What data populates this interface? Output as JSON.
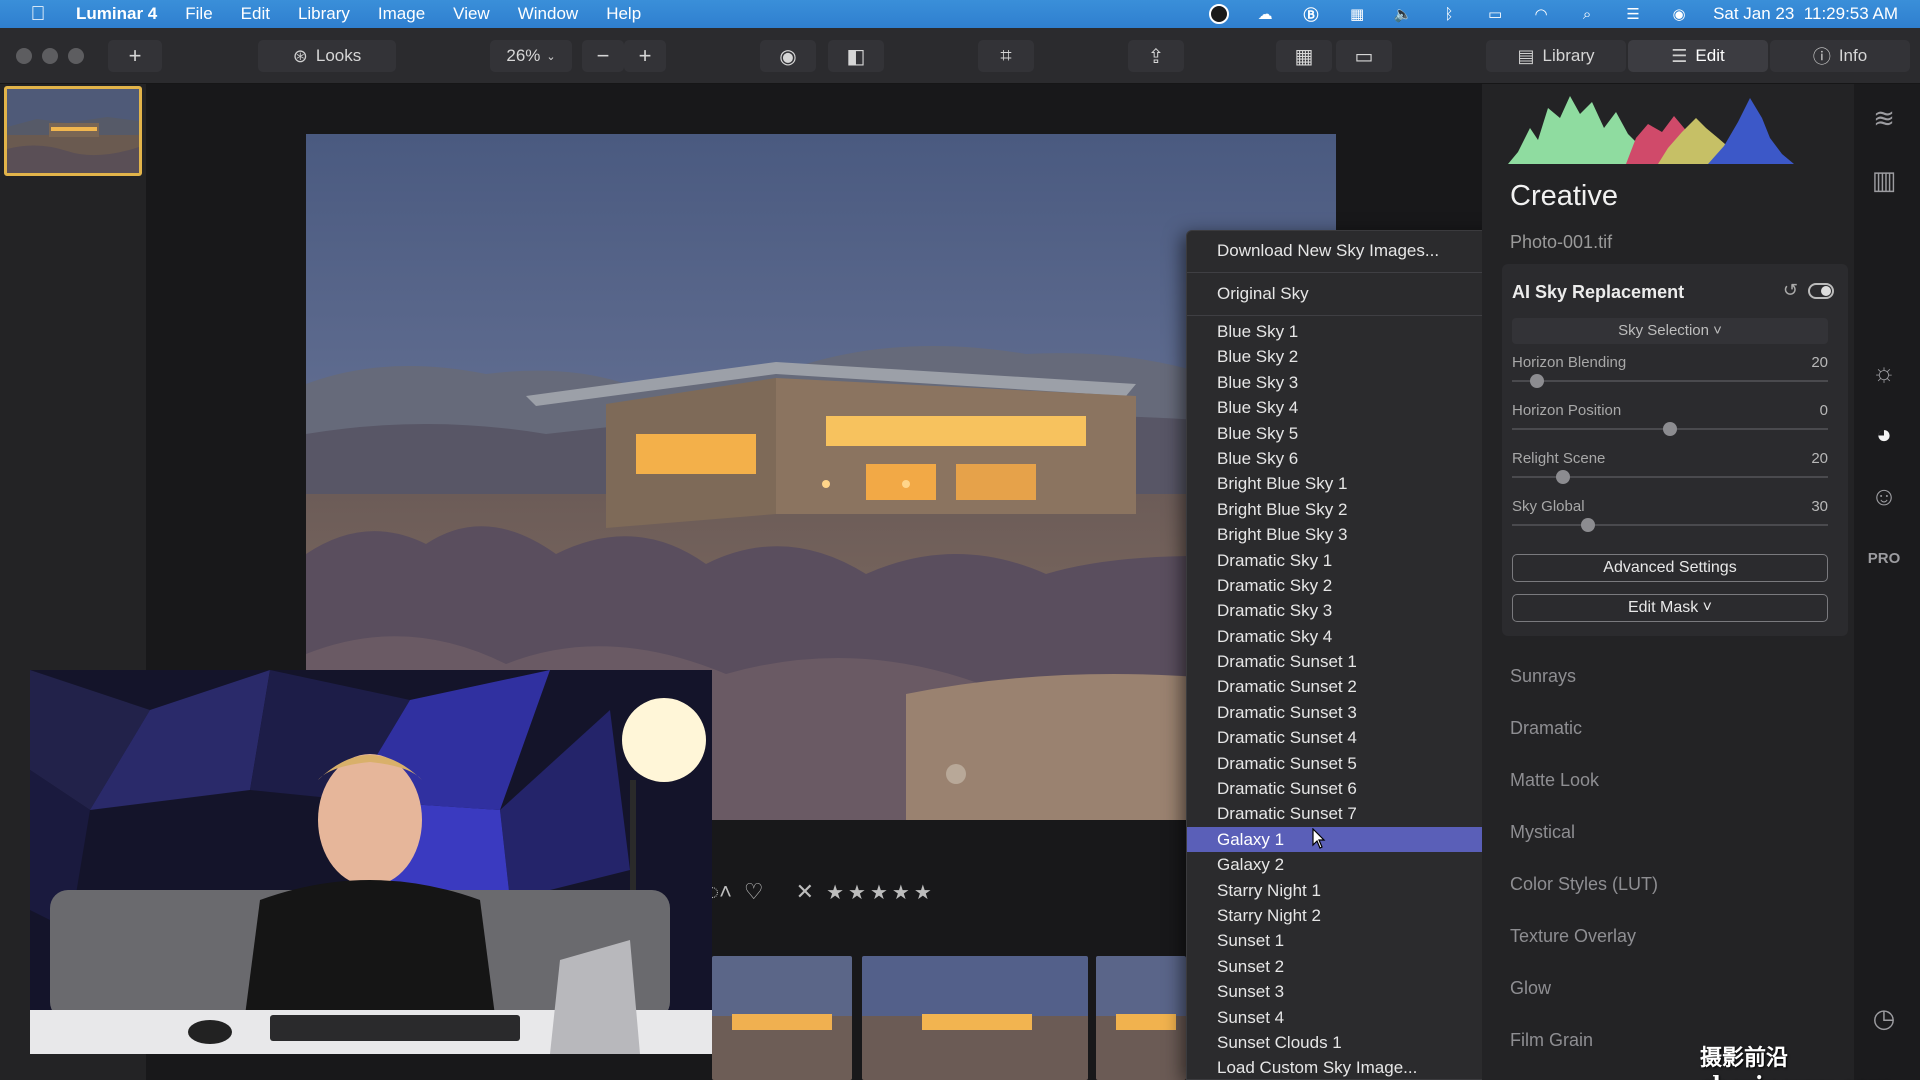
{
  "menubar": {
    "app_name": "Luminar 4",
    "menus": [
      "File",
      "Edit",
      "Library",
      "Image",
      "View",
      "Window",
      "Help"
    ],
    "clock": "Sat Jan 23  11:29:53 AM"
  },
  "toolbar": {
    "looks_label": "Looks",
    "zoom_value": "26%",
    "zoom_out_symbol": "−",
    "zoom_in_symbol": "+",
    "add_symbol": "+",
    "library_label": "Library",
    "edit_label": "Edit",
    "info_label": "Info"
  },
  "dropdown": {
    "download_label": "Download New Sky Images...",
    "original_label": "Original Sky",
    "items": [
      "Blue Sky 1",
      "Blue Sky 2",
      "Blue Sky 3",
      "Blue Sky 4",
      "Blue Sky 5",
      "Blue Sky 6",
      "Bright Blue Sky 1",
      "Bright Blue Sky 2",
      "Bright Blue Sky 3",
      "Dramatic Sky 1",
      "Dramatic Sky 2",
      "Dramatic Sky 3",
      "Dramatic Sky 4",
      "Dramatic Sunset 1",
      "Dramatic Sunset 2",
      "Dramatic Sunset 3",
      "Dramatic Sunset 4",
      "Dramatic Sunset 5",
      "Dramatic Sunset 6",
      "Dramatic Sunset 7",
      "Galaxy 1",
      "Galaxy 2",
      "Starry Night 1",
      "Starry Night 2",
      "Sunset 1",
      "Sunset 2",
      "Sunset 3",
      "Sunset 4",
      "Sunset Clouds 1"
    ],
    "selected": "Galaxy 1",
    "cut_off_item": "Load Custom Sky Image..."
  },
  "panel": {
    "title": "Creative",
    "file_name": "Photo-001.tif",
    "sky_card": {
      "title": "AI Sky Replacement",
      "sky_selection": "Sky Selection ˅",
      "sliders": [
        {
          "label": "Horizon Blending",
          "value": "20",
          "fraction": 0.08
        },
        {
          "label": "Horizon Position",
          "value": "0",
          "fraction": 0.5
        },
        {
          "label": "Relight Scene",
          "value": "20",
          "fraction": 0.16
        },
        {
          "label": "Sky Global",
          "value": "30",
          "fraction": 0.24
        }
      ],
      "advanced_settings": "Advanced Settings",
      "edit_mask": "Edit Mask ˅"
    },
    "tools": [
      "Sunrays",
      "Dramatic",
      "Matte Look",
      "Mystical",
      "Color Styles (LUT)",
      "Texture Overlay",
      "Glow",
      "Film Grain"
    ],
    "pro_badge": "PRO"
  },
  "rating": {
    "stars": "★★★★★",
    "heart": "♡",
    "reject": "✕"
  },
  "watermark": "摄影前沿 sheyingzyz.com",
  "colors": {
    "accent_selected": "#5a5fb8",
    "menubar_blue": "#3a8fd9",
    "thumb_border": "#e2b44a"
  }
}
